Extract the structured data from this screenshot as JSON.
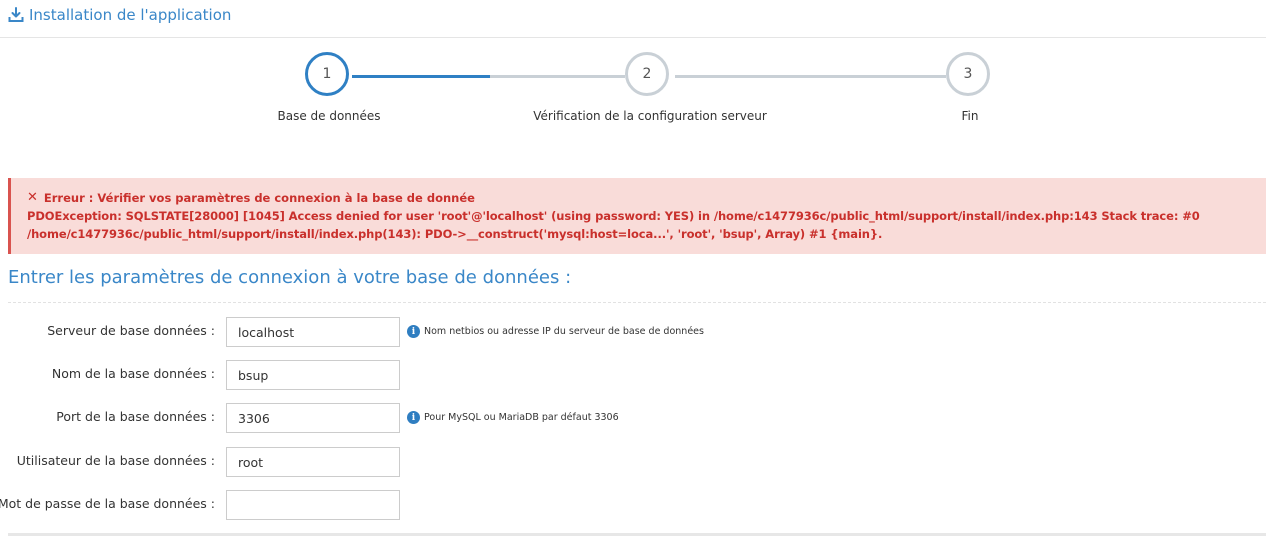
{
  "header": {
    "title": "Installation de l'application",
    "icon": "download-icon",
    "color": "#3a87c8"
  },
  "stepper": {
    "steps": [
      {
        "number": "1",
        "label": "Base de données",
        "active": true
      },
      {
        "number": "2",
        "label": "Vérification de la configuration serveur",
        "active": false
      },
      {
        "number": "3",
        "label": "Fin",
        "active": false
      }
    ],
    "active_color": "#2f80c4",
    "inactive_color": "#c9d0d6"
  },
  "alert": {
    "icon": "close-icon",
    "title": "Erreur : Vérifier vos paramètres de connexion à la base de donnée",
    "message": "PDOException: SQLSTATE[28000] [1045] Access denied for user 'root'@'localhost' (using password: YES) in /home/c1477936c/public_html/support/install/index.php:143 Stack trace: #0 /home/c1477936c/public_html/support/install/index.php(143): PDO->__construct('mysql:host=loca...', 'root', 'bsup', Array) #1 {main}.",
    "color": "#c9302c",
    "background": "#f9dcd9"
  },
  "section": {
    "title": "Entrer les paramètres de connexion à votre base de données :"
  },
  "form": {
    "fields": [
      {
        "label": "Serveur de base données :",
        "value": "localhost",
        "hint": "Nom netbios ou adresse IP du serveur de base de données"
      },
      {
        "label": "Nom de la base données :",
        "value": "bsup",
        "hint": ""
      },
      {
        "label": "Port de la base données :",
        "value": "3306",
        "hint": "Pour MySQL ou MariaDB par défaut 3306"
      },
      {
        "label": "Utilisateur de la base données :",
        "value": "root",
        "hint": ""
      },
      {
        "label": "Mot de passe de la base données :",
        "value": "",
        "hint": ""
      }
    ]
  }
}
